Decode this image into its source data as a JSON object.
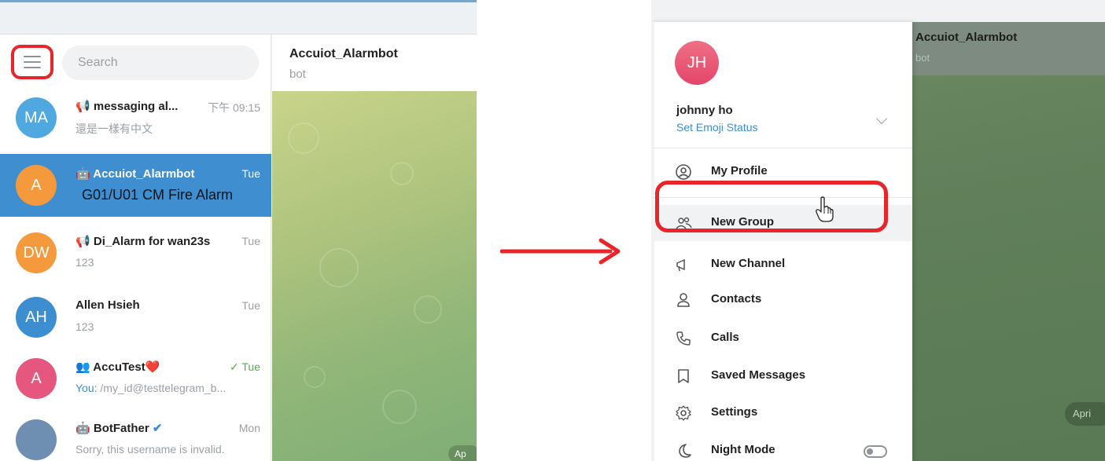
{
  "left": {
    "search_placeholder": "Search",
    "chats": [
      {
        "initials": "MA",
        "color": "#4fa9e0",
        "icon": "megaphone-icon",
        "title": "messaging al...",
        "time": "下午 09:15",
        "subtitle": "還是一樣有中文"
      },
      {
        "initials": "A",
        "color": "#f59a3c",
        "icon": "bot-icon",
        "title": "Accuiot_Alarmbot",
        "time": "Tue",
        "subtitle": "G01/U01 CM Fire Alarm"
      },
      {
        "initials": "DW",
        "color": "#f59a3c",
        "icon": "megaphone-icon",
        "title": "Di_Alarm for wan23s",
        "time": "Tue",
        "subtitle": "123"
      },
      {
        "initials": "AH",
        "color": "#3d8ed0",
        "icon": "",
        "title": "Allen Hsieh",
        "time": "Tue",
        "subtitle": "123"
      },
      {
        "initials": "A",
        "color": "#e5577e",
        "icon": "group-icon",
        "title": "AccuTest❤️",
        "time": "✓ Tue",
        "subtitle_you": "You:",
        "subtitle": " /my_id@testtelegram_b..."
      },
      {
        "initials": "",
        "color": "#6f8fb2",
        "icon": "bot-icon",
        "title": "BotFather",
        "time": "Mon",
        "subtitle": "Sorry, this username is invalid."
      }
    ],
    "header": {
      "name": "Accuiot_Alarmbot",
      "status": "bot"
    },
    "date_pill": "Ap"
  },
  "right": {
    "profile": {
      "initials": "JH",
      "name": "johnny ho",
      "emoji_status": "Set Emoji Status"
    },
    "menu": [
      {
        "icon": "user-circle-icon",
        "label": "My Profile"
      },
      {
        "icon": "group-icon",
        "label": "New Group"
      },
      {
        "icon": "megaphone-icon",
        "label": "New Channel"
      },
      {
        "icon": "person-icon",
        "label": "Contacts"
      },
      {
        "icon": "phone-icon",
        "label": "Calls"
      },
      {
        "icon": "bookmark-icon",
        "label": "Saved Messages"
      },
      {
        "icon": "gear-icon",
        "label": "Settings"
      },
      {
        "icon": "moon-icon",
        "label": "Night Mode"
      }
    ],
    "header": {
      "name": "Accuiot_Alarmbot",
      "status": "bot"
    },
    "date_pill": "Apri"
  },
  "colors": {
    "highlight": "#e8252b",
    "accent": "#3d8ed0"
  }
}
